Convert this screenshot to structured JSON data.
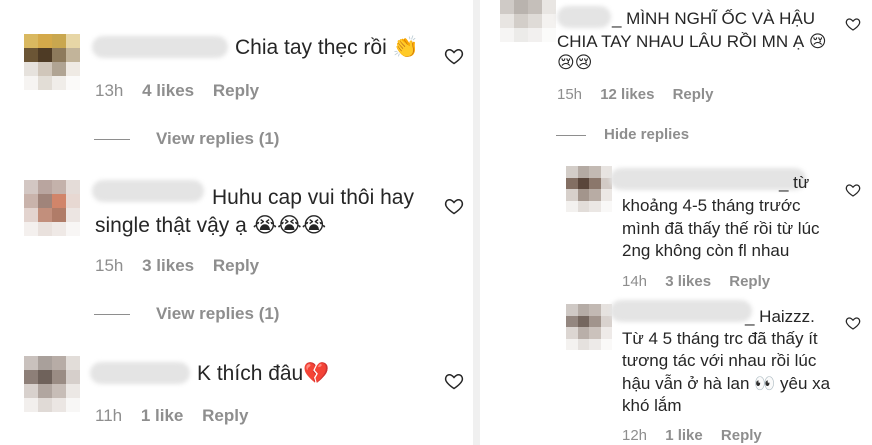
{
  "left": {
    "comments": [
      {
        "text": "Chia tay thẹc rồi ",
        "emoji": "👏",
        "time": "13h",
        "likes": "4 likes",
        "reply": "Reply",
        "view_replies": "View replies (1)"
      },
      {
        "text_line1": "Huhu cap vui thôi hay",
        "text_line2": "single thật vậy ạ ",
        "emoji": "😭😭😭",
        "time": "15h",
        "likes": "3 likes",
        "reply": "Reply",
        "view_replies": "View replies (1)"
      },
      {
        "text": "K thích đâu",
        "emoji": "💔",
        "time": "11h",
        "likes": "1 like",
        "reply": "Reply"
      }
    ]
  },
  "right": {
    "top_comment": {
      "line1": "_ MÌNH NGHĨ ỐC VÀ HẬU",
      "line2": "CHIA TAY NHAU LÂU RỒI MN Ạ ",
      "emoji1": "😢",
      "emoji2": "😢😢",
      "time": "15h",
      "likes": "12 likes",
      "reply": "Reply",
      "hide_replies": "Hide replies"
    },
    "replies": [
      {
        "line1": "_ từ",
        "line2": "khoảng 4-5 tháng trước",
        "line3": "mình đã thấy thế rồi từ lúc",
        "line4": "2ng không còn fl nhau",
        "time": "14h",
        "likes": "3 likes",
        "reply": "Reply"
      },
      {
        "line1": "_ Haizzz.",
        "line2": "Từ 4 5 tháng trc đã thấy ít",
        "line3": "tương tác với nhau rồi lúc",
        "line4": "hậu vẫn ở hà lan ",
        "line4_emoji": "👀",
        "line4_tail": " yêu xa",
        "line5": "khó lắm",
        "time": "12h",
        "likes": "1 like",
        "reply": "Reply"
      }
    ]
  },
  "icons": {
    "heart": "heart-icon"
  }
}
